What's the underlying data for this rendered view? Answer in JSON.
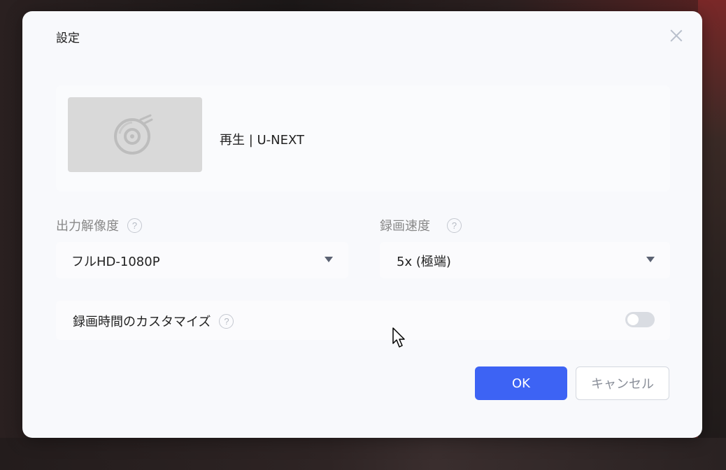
{
  "dialog": {
    "title": "設定"
  },
  "media": {
    "title": "再生 | U-NEXT",
    "thumbnail_icon": "music-disc-icon"
  },
  "resolution": {
    "label": "出力解像度",
    "value": "フルHD-1080P"
  },
  "speed": {
    "label": "録画速度",
    "value": "5x (極端)"
  },
  "custom_duration": {
    "label": "録画時間のカスタマイズ",
    "enabled": false
  },
  "buttons": {
    "ok": "OK",
    "cancel": "キャンセル"
  },
  "help_glyph": "?",
  "colors": {
    "primary": "#3d63f4",
    "dialog_bg": "#f8f9fc",
    "toggle_off": "#d9dce2"
  }
}
